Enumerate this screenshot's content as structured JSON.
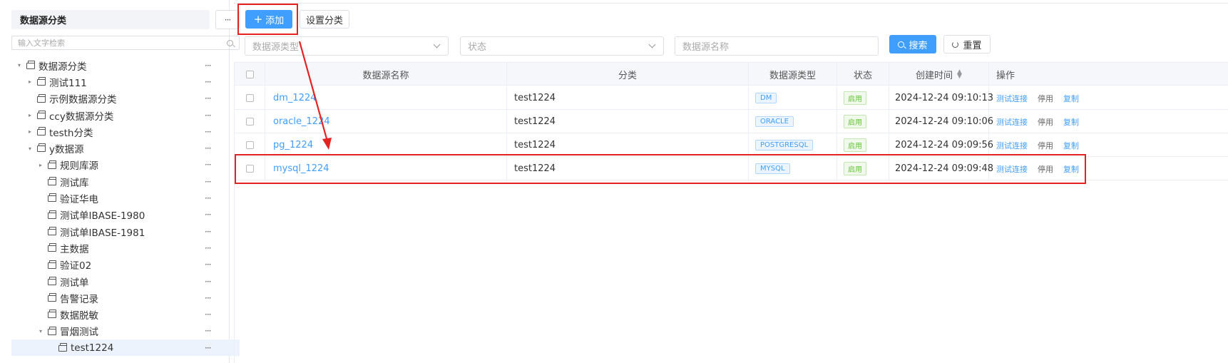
{
  "sidebar": {
    "title": "数据源分类",
    "more": "···",
    "search_placeholder": "输入文字检索",
    "tree": [
      {
        "label": "数据源分类",
        "level": 0,
        "caret": "down"
      },
      {
        "label": "测试111",
        "level": 1,
        "caret": "right"
      },
      {
        "label": "示例数据源分类",
        "level": 1,
        "caret": ""
      },
      {
        "label": "ccy数据源分类",
        "level": 1,
        "caret": "right"
      },
      {
        "label": "testh分类",
        "level": 1,
        "caret": "right"
      },
      {
        "label": "y数据源",
        "level": 1,
        "caret": "down"
      },
      {
        "label": "规则库源",
        "level": 2,
        "caret": "right"
      },
      {
        "label": "测试库",
        "level": 2,
        "caret": ""
      },
      {
        "label": "验证华电",
        "level": 2,
        "caret": ""
      },
      {
        "label": "测试单IBASE-1980",
        "level": 2,
        "caret": ""
      },
      {
        "label": "测试单IBASE-1981",
        "level": 2,
        "caret": ""
      },
      {
        "label": "主数据",
        "level": 2,
        "caret": ""
      },
      {
        "label": "验证02",
        "level": 2,
        "caret": ""
      },
      {
        "label": "测试单",
        "level": 2,
        "caret": ""
      },
      {
        "label": "告警记录",
        "level": 2,
        "caret": ""
      },
      {
        "label": "数据脱敏",
        "level": 2,
        "caret": ""
      },
      {
        "label": "冒烟测试",
        "level": 2,
        "caret": "down"
      },
      {
        "label": "test1224",
        "level": 3,
        "caret": "",
        "selected": true
      }
    ]
  },
  "toolbar": {
    "add_label": "添加",
    "add_icon": "plus-icon",
    "category_label": "设置分类"
  },
  "filters": {
    "type_placeholder": "数据源类型",
    "status_placeholder": "状态",
    "name_placeholder": "数据源名称",
    "search_label": "搜索",
    "reset_label": "重置"
  },
  "table": {
    "headers": {
      "name": "数据源名称",
      "category": "分类",
      "type": "数据源类型",
      "status": "状态",
      "created": "创建时间",
      "ops": "操作"
    },
    "rows": [
      {
        "name": "dm_1224",
        "category": "test1224",
        "type": "DM",
        "status": "启用",
        "created": "2024-12-24 09:10:13",
        "op1": "测试连接",
        "op2": "停用",
        "op3": "复制"
      },
      {
        "name": "oracle_1224",
        "category": "test1224",
        "type": "ORACLE",
        "status": "启用",
        "created": "2024-12-24 09:10:06",
        "op1": "测试连接",
        "op2": "停用",
        "op3": "复制"
      },
      {
        "name": "pg_1224",
        "category": "test1224",
        "type": "POSTGRESQL",
        "status": "启用",
        "created": "2024-12-24 09:09:56",
        "op1": "测试连接",
        "op2": "停用",
        "op3": "复制"
      },
      {
        "name": "mysql_1224",
        "category": "test1224",
        "type": "MYSQL",
        "status": "启用",
        "created": "2024-12-24 09:09:48",
        "op1": "测试连接",
        "op2": "停用",
        "op3": "复制"
      }
    ]
  },
  "colors": {
    "primary": "#409eff",
    "highlight": "#e52222",
    "status_green": "#67c23a"
  }
}
